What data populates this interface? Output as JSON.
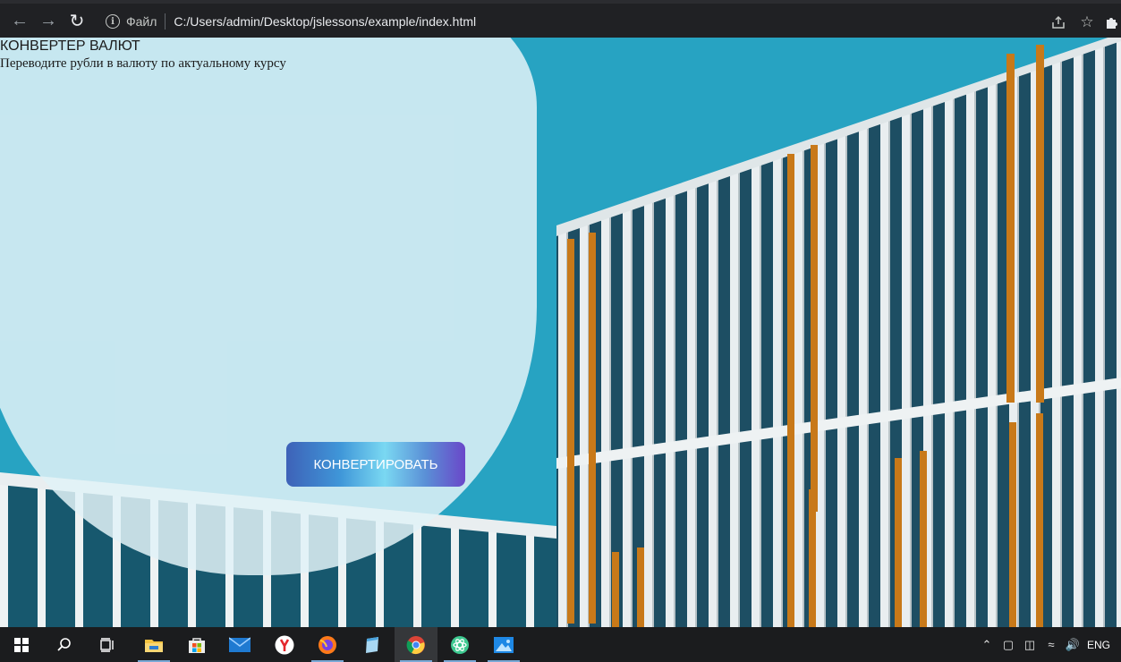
{
  "browser": {
    "back_icon": "arrow-left-icon",
    "forward_icon": "arrow-right-icon",
    "reload_icon": "reload-icon",
    "info_icon": "info-icon",
    "file_label": "Файл",
    "url": "C:/Users/admin/Desktop/jslessons/example/index.html",
    "share_icon": "share-icon",
    "bookmark_icon": "star-icon",
    "extensions_icon": "puzzle-icon"
  },
  "page": {
    "title": "КОНВЕРТЕР ВАЛЮТ",
    "subtitle": "Переводите рубли в валюту по актуальному курсу",
    "convert_button": "КОНВЕРТИРОВАТЬ"
  },
  "taskbar": {
    "apps": [
      "start-icon",
      "search-icon",
      "task-view-icon",
      "file-explorer-icon",
      "microsoft-store-icon",
      "mail-icon",
      "yandex-browser-icon",
      "firefox-icon",
      "notepad-icon",
      "chrome-icon",
      "atom-icon",
      "photos-icon"
    ],
    "language": "ENG"
  },
  "colors": {
    "sky": "#27a3c2",
    "card": "#e1f2f7",
    "button_start": "#3e62b8",
    "button_end": "#6a47c9"
  }
}
